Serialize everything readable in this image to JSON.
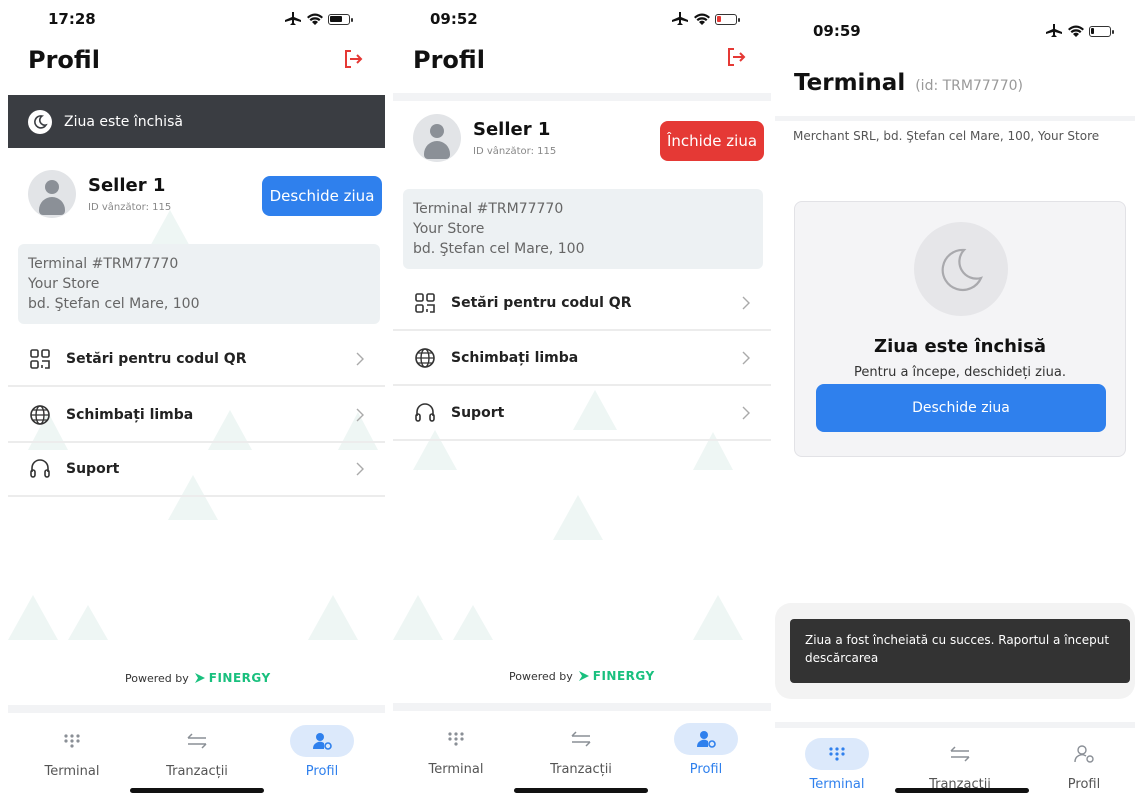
{
  "screen1": {
    "time": "17:28",
    "title": "Profil",
    "banner": "Ziua este închisă",
    "seller_name": "Seller 1",
    "seller_id": "ID vânzător: 115",
    "open_day_button": "Deschide ziua",
    "terminal_lines": [
      "Terminal #TRM77770",
      "Your Store",
      "bd. Ştefan cel Mare, 100"
    ],
    "menu": [
      "Setări pentru codul QR",
      "Schimbați limba",
      "Suport"
    ],
    "powered_by": "Powered by",
    "brand": "FINERGY",
    "tabs": [
      "Terminal",
      "Tranzacții",
      "Profil"
    ]
  },
  "screen2": {
    "time": "09:52",
    "title": "Profil",
    "seller_name": "Seller 1",
    "seller_id": "ID vânzător: 115",
    "close_day_button": "Închide ziua",
    "terminal_lines": [
      "Terminal #TRM77770",
      "Your Store",
      "bd. Ştefan cel Mare, 100"
    ],
    "menu": [
      "Setări pentru codul QR",
      "Schimbați limba",
      "Suport"
    ],
    "powered_by": "Powered by",
    "brand": "FINERGY",
    "tabs": [
      "Terminal",
      "Tranzacții",
      "Profil"
    ]
  },
  "screen3": {
    "time": "09:59",
    "title": "Terminal",
    "terminal_id": "(id: TRM77770)",
    "merchant": "Merchant SRL, bd. Ştefan cel Mare, 100, Your Store",
    "closed_title": "Ziua este închisă",
    "closed_sub": "Pentru a începe, deschideți ziua.",
    "open_day_button": "Deschide ziua",
    "toast": "Ziua a fost încheiată cu succes. Raportul a început descărcarea",
    "tabs": [
      "Terminal",
      "Tranzacții",
      "Profil"
    ]
  },
  "colors": {
    "accent": "#2f80ed",
    "danger": "#e53935",
    "banner": "#3a3d42",
    "brand": "#19c07e"
  },
  "icons": [
    "airplane-icon",
    "wifi-icon",
    "battery-icon",
    "logout-icon",
    "moon-icon",
    "qr-code-icon",
    "globe-icon",
    "headset-icon",
    "chevron-right-icon",
    "keypad-icon",
    "transfer-icon",
    "user-settings-icon"
  ]
}
